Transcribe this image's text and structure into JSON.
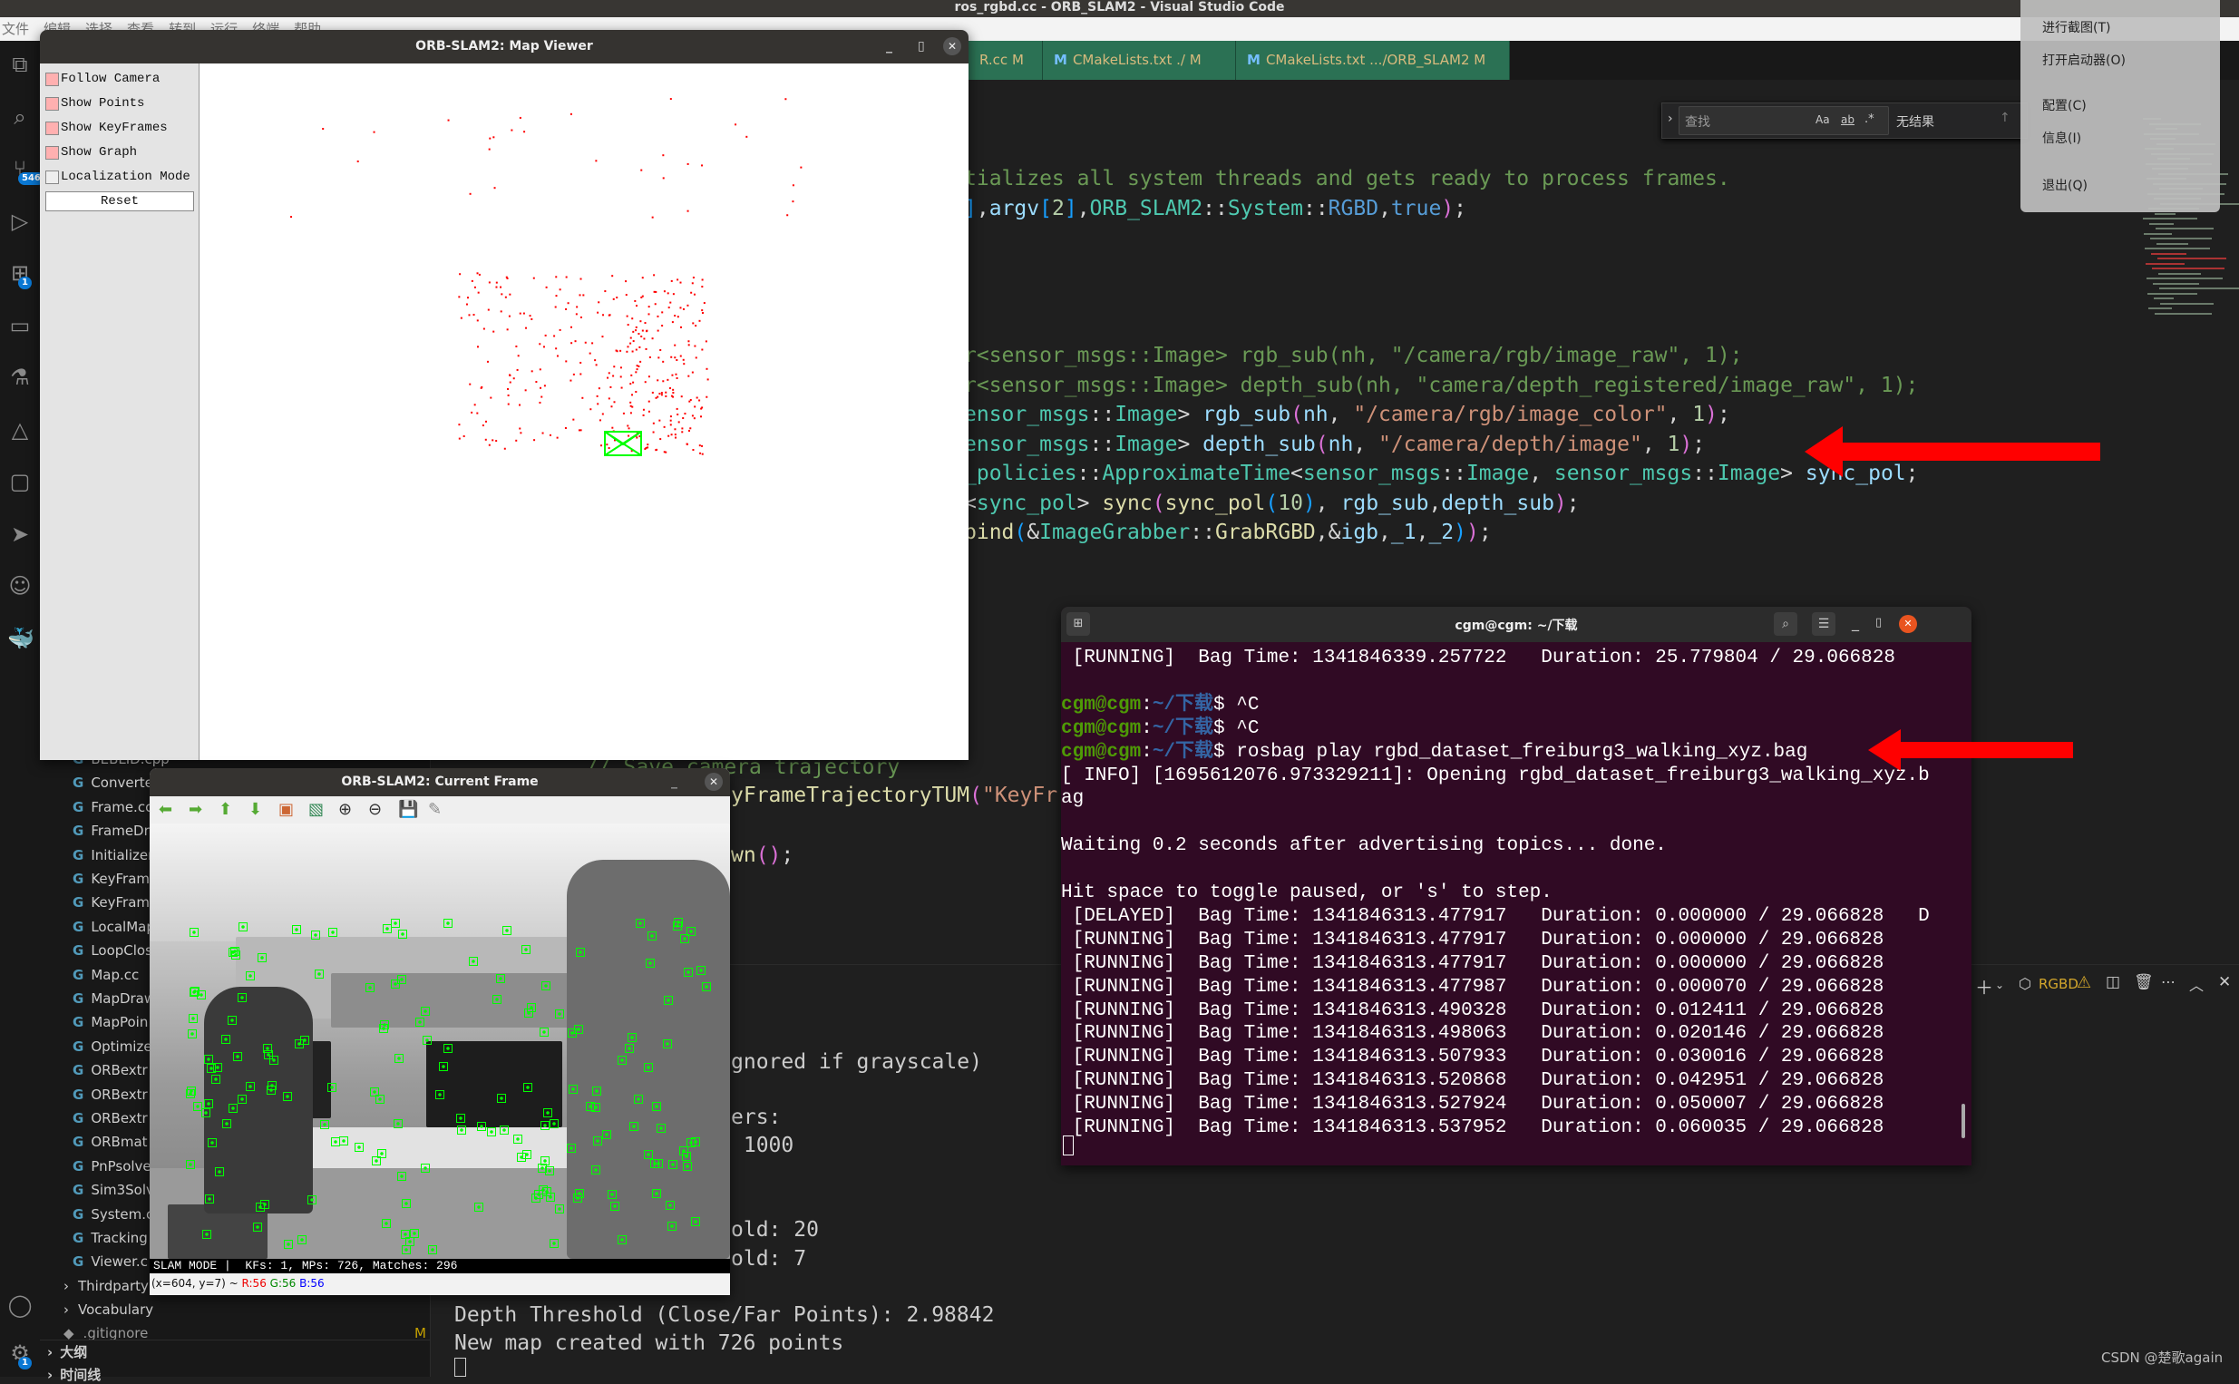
{
  "window_title": "ros_rgbd.cc - ORB_SLAM2 - Visual Studio Code",
  "menu": [
    "文件",
    "编辑",
    "选择",
    "查看",
    "转到",
    "运行",
    "终端",
    "帮助"
  ],
  "activity_bar": {
    "icons": [
      "files-icon",
      "search-icon",
      "source-control-icon",
      "run-debug-icon",
      "extensions-icon",
      "remote-explorer-icon",
      "testing-icon",
      "cmake-icon",
      "comments-icon",
      "pointer-icon",
      "copilot-icon",
      "docker-icon",
      "account-icon",
      "settings-icon"
    ],
    "scm_badge": "546",
    "extensions_badge": "1",
    "settings_badge": "1"
  },
  "explorer": {
    "files": [
      "BEBLID.cpp",
      "Converte",
      "Frame.cc",
      "FrameDr",
      "Initializer",
      "KeyFram",
      "KeyFram",
      "LocalMap",
      "LoopClos",
      "Map.cc",
      "MapDraw",
      "MapPoin",
      "Optimize",
      "ORBextr",
      "ORBextr",
      "ORBextr",
      "ORBmat",
      "PnPsolve",
      "Sim3Solv",
      "System.c",
      "Tracking",
      "Viewer.c"
    ],
    "folders": [
      "Thirdparty",
      "Vocabulary"
    ],
    "gitignore": ".gitignore",
    "gitignore_status": "M",
    "outline": "大纲",
    "timeline": "时间线"
  },
  "tabs": [
    {
      "label": "R.cc",
      "status": "M"
    },
    {
      "label": "CMakeLists.txt ./",
      "status": "M"
    },
    {
      "label": "CMakeLists.txt .../ORB_SLAM2",
      "status": "M"
    }
  ],
  "find": {
    "placeholder": "查找",
    "case": "Aa",
    "word": "ab",
    "regex": ".*",
    "result": "无结果"
  },
  "tray_menu": [
    "进行截图(T)",
    "打开启动器(O)",
    "配置(C)",
    "信息(I)",
    "退出(Q)"
  ],
  "code": [
    [
      [
        "comment",
        "tializes all system threads and gets ready to process frames."
      ]
    ],
    [
      [
        "br2",
        "]"
      ],
      [
        "punc",
        ","
      ],
      [
        "var",
        "argv"
      ],
      [
        "br2",
        "["
      ],
      [
        "num",
        "2"
      ],
      [
        "br2",
        "]"
      ],
      [
        "punc",
        ","
      ],
      [
        "type",
        "ORB_SLAM2"
      ],
      [
        "punc",
        "::"
      ],
      [
        "type",
        "System"
      ],
      [
        "punc",
        "::"
      ],
      [
        "kw",
        "RGBD"
      ],
      [
        "punc",
        ","
      ],
      [
        "kw",
        "true"
      ],
      [
        "br1",
        ")"
      ],
      [
        "punc",
        ";"
      ]
    ],
    [
      [
        "comment",
        "r<sensor_msgs::Image> rgb_sub(nh, \"/camera/rgb/image_raw\", 1);"
      ]
    ],
    [
      [
        "comment",
        "r<sensor_msgs::Image> depth_sub(nh, \"camera/depth_registered/image_raw\", 1);"
      ]
    ],
    [
      [
        "type",
        "ensor_msgs"
      ],
      [
        "punc",
        "::"
      ],
      [
        "type",
        "Image"
      ],
      [
        "punc",
        "> "
      ],
      [
        "var",
        "rgb_sub"
      ],
      [
        "br1",
        "("
      ],
      [
        "var",
        "nh"
      ],
      [
        "punc",
        ", "
      ],
      [
        "str",
        "\"/camera/rgb/image_color\""
      ],
      [
        "punc",
        ", "
      ],
      [
        "num",
        "1"
      ],
      [
        "br1",
        ")"
      ],
      [
        "punc",
        ";"
      ]
    ],
    [
      [
        "type",
        "ensor_msgs"
      ],
      [
        "punc",
        "::"
      ],
      [
        "type",
        "Image"
      ],
      [
        "punc",
        "> "
      ],
      [
        "var",
        "depth_sub"
      ],
      [
        "br1",
        "("
      ],
      [
        "var",
        "nh"
      ],
      [
        "punc",
        ", "
      ],
      [
        "str",
        "\"/camera/depth/image\""
      ],
      [
        "punc",
        ", "
      ],
      [
        "num",
        "1"
      ],
      [
        "br1",
        ")"
      ],
      [
        "punc",
        ";"
      ]
    ],
    [
      [
        "type",
        "_policies"
      ],
      [
        "punc",
        "::"
      ],
      [
        "type",
        "ApproximateTime"
      ],
      [
        "punc",
        "<"
      ],
      [
        "type",
        "sensor_msgs"
      ],
      [
        "punc",
        "::"
      ],
      [
        "type",
        "Image"
      ],
      [
        "punc",
        ", "
      ],
      [
        "type",
        "sensor_msgs"
      ],
      [
        "punc",
        "::"
      ],
      [
        "type",
        "Image"
      ],
      [
        "punc",
        "> "
      ],
      [
        "var",
        "sync_pol"
      ],
      [
        "punc",
        ";"
      ]
    ],
    [
      [
        "punc",
        "<"
      ],
      [
        "type",
        "sync_pol"
      ],
      [
        "punc",
        "> "
      ],
      [
        "fn",
        "sync"
      ],
      [
        "br1",
        "("
      ],
      [
        "fn",
        "sync_pol"
      ],
      [
        "br2",
        "("
      ],
      [
        "num",
        "10"
      ],
      [
        "br2",
        ")"
      ],
      [
        "punc",
        ", "
      ],
      [
        "var",
        "rgb_sub"
      ],
      [
        "punc",
        ","
      ],
      [
        "var",
        "depth_sub"
      ],
      [
        "br1",
        ")"
      ],
      [
        "punc",
        ";"
      ]
    ],
    [
      [
        "fn",
        "bind"
      ],
      [
        "br2",
        "("
      ],
      [
        "punc",
        "&"
      ],
      [
        "type",
        "ImageGrabber"
      ],
      [
        "punc",
        "::"
      ],
      [
        "fn",
        "GrabRGBD"
      ],
      [
        "punc",
        ",&"
      ],
      [
        "var",
        "igb"
      ],
      [
        "punc",
        ","
      ],
      [
        "var",
        "_1"
      ],
      [
        "punc",
        ","
      ],
      [
        "var",
        "_2"
      ],
      [
        "br2",
        ")"
      ],
      [
        "br1",
        ")"
      ],
      [
        "punc",
        ";"
      ]
    ]
  ],
  "code_lower": [
    [
      [
        "comment",
        "// Save camera trajectory"
      ]
    ],
    [
      [
        "fn",
        "yFrameTrajectoryTUM"
      ],
      [
        "br1",
        "("
      ],
      [
        "str",
        "\"KeyFr"
      ]
    ],
    [
      [
        "fn",
        "wn"
      ],
      [
        "br1",
        "()"
      ],
      [
        "punc",
        ";"
      ]
    ]
  ],
  "output_lines": [
    "gnored if grayscale)",
    "ers:",
    " 1000",
    "old: 20",
    "old: 7",
    "Depth Threshold (Close/Far Points): 2.98842",
    "New map created with 726 points"
  ],
  "panel_toolbar": {
    "profile": "RGBD"
  },
  "map_viewer": {
    "title": "ORB-SLAM2: Map Viewer",
    "options": [
      {
        "label": "Follow Camera",
        "checked": true
      },
      {
        "label": "Show Points",
        "checked": true
      },
      {
        "label": "Show KeyFrames",
        "checked": true
      },
      {
        "label": "Show Graph",
        "checked": true
      },
      {
        "label": "Localization Mode",
        "checked": false
      }
    ],
    "reset": "Reset",
    "point_color": "#ff0000",
    "keyframe_color": "#00ff00"
  },
  "current_frame": {
    "title": "ORB-SLAM2: Current Frame",
    "status": "SLAM MODE |  KFs: 1, MPs: 726, Matches: 296",
    "coords": "(x=604, y=7) ~",
    "r": "R:56",
    "g": "G:56",
    "b": "B:56",
    "toolbar": [
      "pan-left-icon",
      "pan-right-icon",
      "pan-up-icon",
      "pan-down-icon",
      "zoom-fit-icon",
      "zoom-original-icon",
      "zoom-in-icon",
      "zoom-out-icon",
      "save-icon",
      "properties-icon"
    ]
  },
  "terminal": {
    "title": "cgm@cgm: ~/下载",
    "prompt_user": "cgm@cgm",
    "prompt_path": "~/下载",
    "lines": [
      {
        "text": " [RUNNING]  Bag Time: 1341846339.257722   Duration: 25.779804 / 29.066828"
      },
      {
        "text": ""
      },
      {
        "prompt": true,
        "text": " ^C"
      },
      {
        "prompt": true,
        "text": " ^C"
      },
      {
        "prompt": true,
        "text": " rosbag play rgbd_dataset_freiburg3_walking_xyz.bag"
      },
      {
        "text": "[ INFO] [1695612076.973329211]: Opening rgbd_dataset_freiburg3_walking_xyz.b"
      },
      {
        "text": "ag"
      },
      {
        "text": ""
      },
      {
        "text": "Waiting 0.2 seconds after advertising topics... done."
      },
      {
        "text": ""
      },
      {
        "text": "Hit space to toggle paused, or 's' to step."
      },
      {
        "text": " [DELAYED]  Bag Time: 1341846313.477917   Duration: 0.000000 / 29.066828   D"
      },
      {
        "text": " [RUNNING]  Bag Time: 1341846313.477917   Duration: 0.000000 / 29.066828"
      },
      {
        "text": " [RUNNING]  Bag Time: 1341846313.477917   Duration: 0.000000 / 29.066828"
      },
      {
        "text": " [RUNNING]  Bag Time: 1341846313.477987   Duration: 0.000070 / 29.066828"
      },
      {
        "text": " [RUNNING]  Bag Time: 1341846313.490328   Duration: 0.012411 / 29.066828"
      },
      {
        "text": " [RUNNING]  Bag Time: 1341846313.498063   Duration: 0.020146 / 29.066828"
      },
      {
        "text": " [RUNNING]  Bag Time: 1341846313.507933   Duration: 0.030016 / 29.066828"
      },
      {
        "text": " [RUNNING]  Bag Time: 1341846313.520868   Duration: 0.042951 / 29.066828"
      },
      {
        "text": " [RUNNING]  Bag Time: 1341846313.527924   Duration: 0.050007 / 29.066828"
      },
      {
        "text": " [RUNNING]  Bag Time: 1341846313.537952   Duration: 0.060035 / 29.066828"
      }
    ]
  },
  "watermark": "CSDN @楚歌again"
}
